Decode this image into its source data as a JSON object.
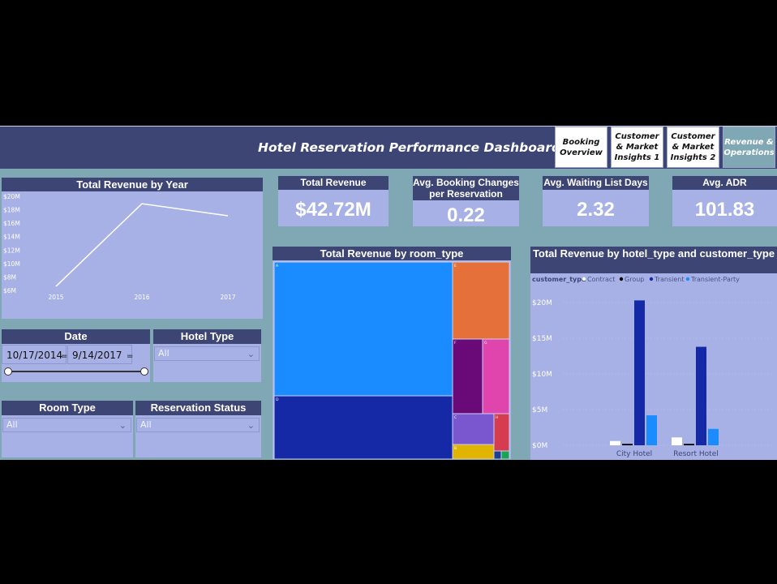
{
  "header": {
    "title": "Hotel Reservation Performance Dashboard"
  },
  "nav": [
    {
      "label": "Booking Overview",
      "active": false
    },
    {
      "label": "Customer & Market Insights 1",
      "active": false
    },
    {
      "label": "Customer & Market Insights 2",
      "active": false
    },
    {
      "label": "Revenue & Operations",
      "active": true
    }
  ],
  "kpis": {
    "total_revenue": {
      "label": "Total Revenue",
      "value": "$42.72M"
    },
    "avg_booking_changes": {
      "label": "Avg. Booking Changes per Reservation",
      "value": "0.22"
    },
    "avg_waiting_days": {
      "label": "Avg. Waiting List Days",
      "value": "2.32"
    },
    "avg_adr": {
      "label": "Avg. ADR",
      "value": "101.83"
    }
  },
  "slicers": {
    "date": {
      "label": "Date",
      "start": "10/17/2014",
      "end": "9/14/2017"
    },
    "hotel_type": {
      "label": "Hotel Type",
      "value": "All"
    },
    "room_type": {
      "label": "Room Type",
      "value": "All"
    },
    "reservation_status": {
      "label": "Reservation Status",
      "value": "All"
    }
  },
  "colors": {
    "header": "#3d4575",
    "panel": "#a7b1e6",
    "background": "#7fa8b4",
    "contract": "#ffffff",
    "group": "#000000",
    "transient": "#1529a6",
    "transient_party": "#1a8cff"
  },
  "chart_data": [
    {
      "type": "line",
      "title": "Total Revenue by Year",
      "x": [
        "2015",
        "2016",
        "2017"
      ],
      "values": [
        6.6,
        18.9,
        17.1
      ],
      "y_ticks": [
        "$20M",
        "$18M",
        "$16M",
        "$14M",
        "$12M",
        "$10M",
        "$8M",
        "$6M"
      ],
      "ylim": [
        6,
        20
      ],
      "line_color": "#ffffff"
    },
    {
      "type": "treemap",
      "title": "Total Revenue by room_type",
      "items": [
        {
          "label": "A",
          "color": "#1a8cff"
        },
        {
          "label": "D",
          "color": "#1529a6"
        },
        {
          "label": "E",
          "color": "#e5703a"
        },
        {
          "label": "F",
          "color": "#6a0a78"
        },
        {
          "label": "G",
          "color": "#e044ad"
        },
        {
          "label": "C",
          "color": "#7b57cf"
        },
        {
          "label": "H",
          "color": "#d63c50"
        },
        {
          "label": "B",
          "color": "#e0b400"
        },
        {
          "label": "",
          "color": "#1f3d91"
        },
        {
          "label": "",
          "color": "#1aa352"
        }
      ]
    },
    {
      "type": "bar",
      "title": "Total Revenue by hotel_type and customer_type",
      "legend_title": "customer_type",
      "categories": [
        "City Hotel",
        "Resort Hotel"
      ],
      "series": [
        {
          "name": "Contract",
          "values": [
            0.6,
            1.1
          ]
        },
        {
          "name": "Group",
          "values": [
            0.2,
            0.2
          ]
        },
        {
          "name": "Transient",
          "values": [
            20.3,
            13.8
          ]
        },
        {
          "name": "Transient-Party",
          "values": [
            4.2,
            2.3
          ]
        }
      ],
      "y_ticks": [
        "$20M",
        "$15M",
        "$10M",
        "$5M",
        "$0M"
      ],
      "ylim": [
        0,
        20
      ],
      "legend": "top"
    }
  ]
}
